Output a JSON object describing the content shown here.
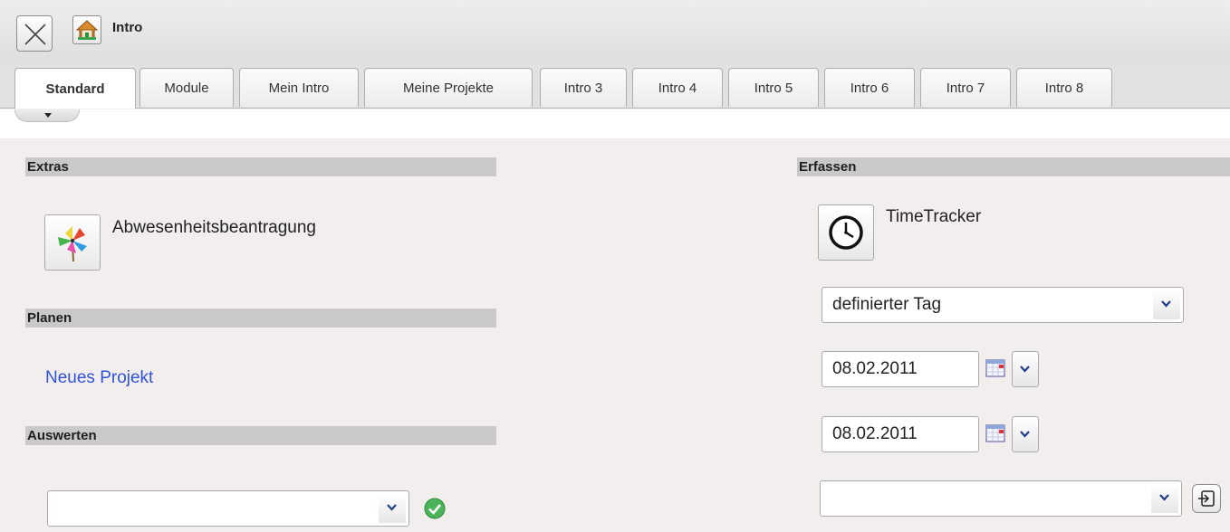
{
  "window": {
    "title": "Intro",
    "close_icon": "close-x-icon",
    "home_icon": "home-icon"
  },
  "tabs": [
    {
      "label": "Standard",
      "active": true
    },
    {
      "label": "Module"
    },
    {
      "label": "Mein Intro"
    },
    {
      "label": "Meine Projekte"
    },
    {
      "label": "Intro 3"
    },
    {
      "label": "Intro 4"
    },
    {
      "label": "Intro 5"
    },
    {
      "label": "Intro 6"
    },
    {
      "label": "Intro 7"
    },
    {
      "label": "Intro 8"
    }
  ],
  "left": {
    "extras": {
      "header": "Extras",
      "items": [
        {
          "label": "Abwesenheitsbeantragung",
          "icon": "pinwheel-icon"
        }
      ]
    },
    "planen": {
      "header": "Planen",
      "link": "Neues Projekt"
    },
    "auswerten": {
      "header": "Auswerten",
      "select_value": "",
      "confirm_icon": "green-check-icon"
    }
  },
  "right": {
    "erfassen": {
      "header": "Erfassen",
      "tracker_label": "TimeTracker",
      "tracker_icon": "clock-icon",
      "period_select": "definierter Tag",
      "date_from": "08.02.2011",
      "date_to": "08.02.2011",
      "bottom_select_value": "",
      "go_icon": "enter-arrow-icon"
    }
  },
  "colors": {
    "background": "#f2eeee",
    "section_header": "#cac8c8",
    "link": "#2f52d8",
    "check_green": "#4cb35a"
  }
}
